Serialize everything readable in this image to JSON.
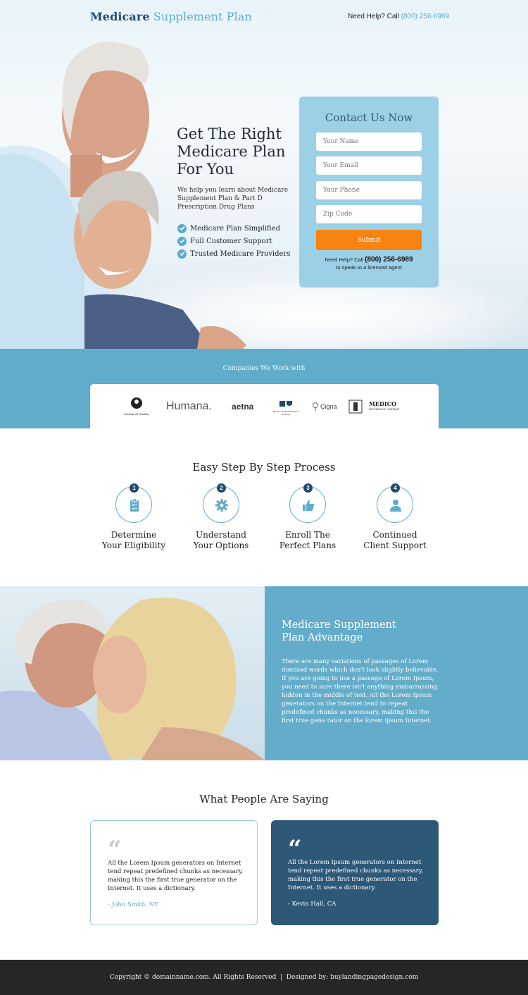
{
  "header": {
    "brand_bold": "Medicare",
    "brand_light": " Supplement Plan",
    "help_prefix": "Need Help? Call ",
    "help_phone": "(800) 256-6989"
  },
  "hero": {
    "headline": "Get The Right Medicare Plan For You",
    "subtext": "We help you learn about Medicare Supplement Plan & Part D Prescription Drug Plans",
    "bullets": [
      "Medicare Plan Simplified",
      "Full Customer Support",
      "Trusted Medicare Providers"
    ]
  },
  "form": {
    "title": "Contact Us Now",
    "name_placeholder": "Your Name",
    "email_placeholder": "Your Email",
    "phone_placeholder": "Your Phone",
    "zip_placeholder": "Zip Code",
    "submit_label": "Submit",
    "note_prefix": "Need Help? Call ",
    "note_phone": "(800) 256-6989",
    "note_suffix": "to speak to a licensed agent"
  },
  "companies": {
    "label": "Companies We Work with",
    "logos": [
      "Mutual of Omaha",
      "Humana.",
      "aetna",
      "BlueCross BlueShield of Arizona",
      "Cigna",
      "MEDICO",
      "INSURANCE COMPANY"
    ]
  },
  "process": {
    "title": "Easy Step By Step Process",
    "steps": [
      {
        "num": "1",
        "line1": "Determine",
        "line2": "Your Eligibility",
        "icon": "clipboard-icon"
      },
      {
        "num": "2",
        "line1": "Understand",
        "line2": "Your Options",
        "icon": "gear-icon"
      },
      {
        "num": "3",
        "line1": "Enroll The",
        "line2": "Perfect Plans",
        "icon": "thumbs-up-icon"
      },
      {
        "num": "4",
        "line1": "Continued",
        "line2": "Client Support",
        "icon": "user-icon"
      }
    ]
  },
  "advantage": {
    "title_line1": "Medicare Supplement",
    "title_line2": "Plan Advantage",
    "body": "There are many variations of passages of Lorem domised words which don't look slightly believable. If you are going to use a passage of Lorem Ipsum, you need to sure there isn't anything embarrassing hidden in the middle of text. All the Lorem Ipsum generators on the Internet tend to repeat predefined chunks as necessary, making this the first true gene rator on the lorem ipsum Internet."
  },
  "testimonials": {
    "title": "What People Are Saying",
    "items": [
      {
        "text": "All the Lorem Ipsum generators on Internet tend repeat predefined chunks as necessary, making this the first true generator on the Internet. It uses a dictionary.",
        "author": "- John Smith, NY"
      },
      {
        "text": "All the Lorem Ipsum generators on Internet tend repeat predefined chunks as necessary, making this the first true generator on the Internet. It uses a dictionary.",
        "author": "- Kevin Hall, CA"
      }
    ]
  },
  "footer": {
    "text": "Copyright © domainname.com. All Rights Reserved  |  Designed by: buylandingpagedesign.com"
  },
  "colors": {
    "accent": "#5fadca",
    "navy": "#1f4a6e",
    "orange": "#f78410",
    "form_bg": "#9cd0e6",
    "dark_card": "#2d5878"
  }
}
